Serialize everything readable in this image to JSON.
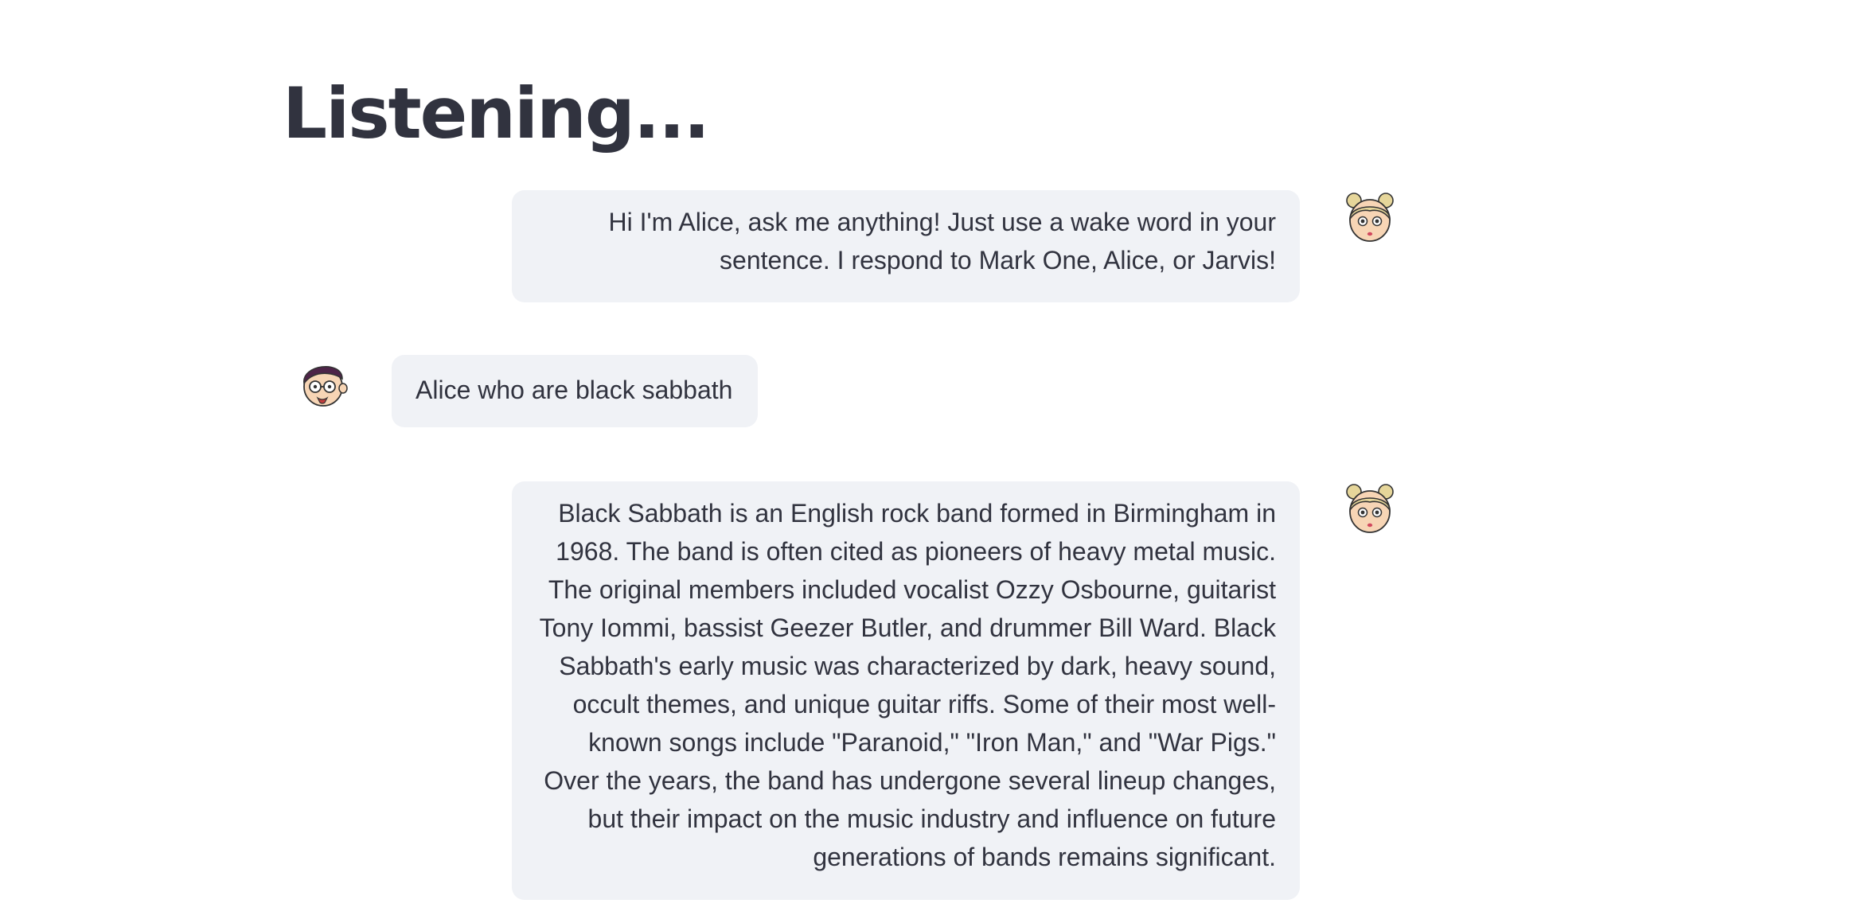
{
  "header": {
    "title": "Listening..."
  },
  "chat": {
    "messages": [
      {
        "role": "assistant",
        "avatar_icon": "alice-girl-avatar-icon",
        "text": "Hi I'm Alice, ask me anything! Just use a wake word in your sentence. I respond to Mark One, Alice, or Jarvis!"
      },
      {
        "role": "user",
        "avatar_icon": "user-boy-with-glasses-avatar-icon",
        "text": "Alice who are black sabbath"
      },
      {
        "role": "assistant",
        "avatar_icon": "alice-girl-avatar-icon",
        "text": "Black Sabbath is an English rock band formed in Birmingham in 1968. The band is often cited as pioneers of heavy metal music. The original members included vocalist Ozzy Osbourne, guitarist Tony Iommi, bassist Geezer Butler, and drummer Bill Ward. Black Sabbath's early music was characterized by dark, heavy sound, occult themes, and unique guitar riffs. Some of their most well-known songs include \"Paranoid,\" \"Iron Man,\" and \"War Pigs.\" Over the years, the band has undergone several lineup changes, but their impact on the music industry and influence on future generations of bands remains significant."
      }
    ]
  },
  "colors": {
    "text": "#31333f",
    "bubble_background": "#f0f2f6",
    "page_background": "#ffffff"
  }
}
